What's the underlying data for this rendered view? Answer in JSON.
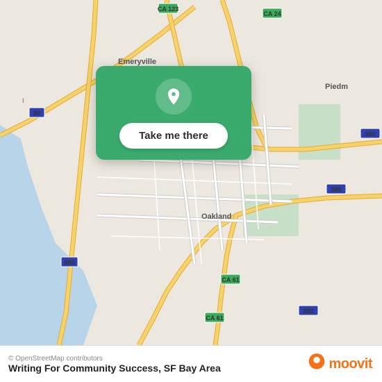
{
  "map": {
    "center": "Oakland, CA",
    "attribution": "© OpenStreetMap contributors"
  },
  "card": {
    "button_label": "Take me there"
  },
  "bottom_bar": {
    "osm_credit": "© OpenStreetMap contributors",
    "venue_name": "Writing For Community Success, SF Bay Area",
    "moovit_text": "moovit"
  }
}
